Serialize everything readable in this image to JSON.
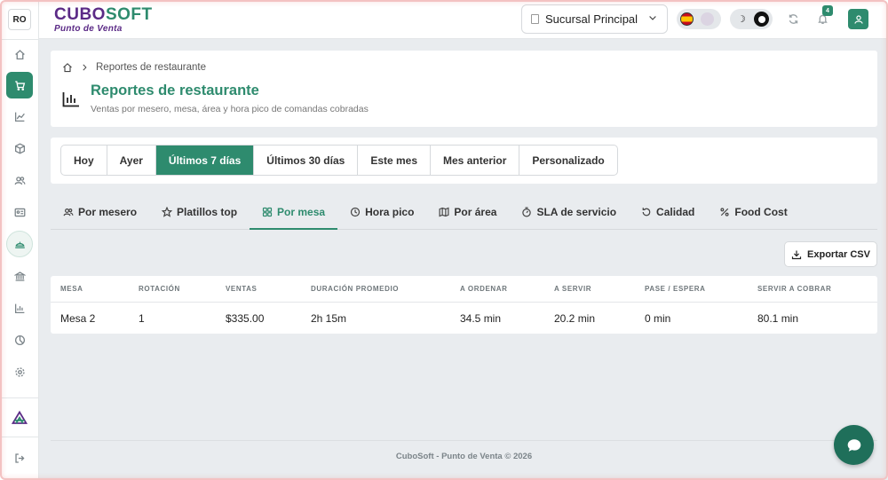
{
  "user": {
    "initials": "RO"
  },
  "brand": {
    "part1": "CUBO",
    "part2": "SOFT",
    "subtitle": "Punto de Venta"
  },
  "header": {
    "branch": "Sucursal Principal",
    "notifications_count": "4"
  },
  "breadcrumb": {
    "current": "Reportes de restaurante"
  },
  "page": {
    "title": "Reportes de restaurante",
    "subtitle": "Ventas por mesero, mesa, área y hora pico de comandas cobradas"
  },
  "ranges": [
    {
      "label": "Hoy",
      "active": false
    },
    {
      "label": "Ayer",
      "active": false
    },
    {
      "label": "Últimos 7 días",
      "active": true
    },
    {
      "label": "Últimos 30 días",
      "active": false
    },
    {
      "label": "Este mes",
      "active": false
    },
    {
      "label": "Mes anterior",
      "active": false
    },
    {
      "label": "Personalizado",
      "active": false
    }
  ],
  "tabs": [
    {
      "label": "Por mesero",
      "icon": "users-icon"
    },
    {
      "label": "Platillos top",
      "icon": "star-icon"
    },
    {
      "label": "Por mesa",
      "icon": "grid-icon",
      "active": true
    },
    {
      "label": "Hora pico",
      "icon": "clock-icon"
    },
    {
      "label": "Por área",
      "icon": "map-icon"
    },
    {
      "label": "SLA de servicio",
      "icon": "timer-icon"
    },
    {
      "label": "Calidad",
      "icon": "rotate-icon"
    },
    {
      "label": "Food Cost",
      "icon": "percent-icon"
    }
  ],
  "export_label": "Exportar CSV",
  "table": {
    "headers": [
      "MESA",
      "ROTACIÓN",
      "VENTAS",
      "DURACIÓN PROMEDIO",
      "A ORDENAR",
      "A SERVIR",
      "PASE / ESPERA",
      "SERVIR A COBRAR"
    ],
    "rows": [
      [
        "Mesa 2",
        "1",
        "$335.00",
        "2h 15m",
        "34.5 min",
        "20.2 min",
        "0 min",
        "80.1 min"
      ]
    ]
  },
  "footer": "CuboSoft - Punto de Venta © 2026",
  "colors": {
    "accent": "#2e8b6e",
    "brand_purple": "#5b2a86"
  }
}
